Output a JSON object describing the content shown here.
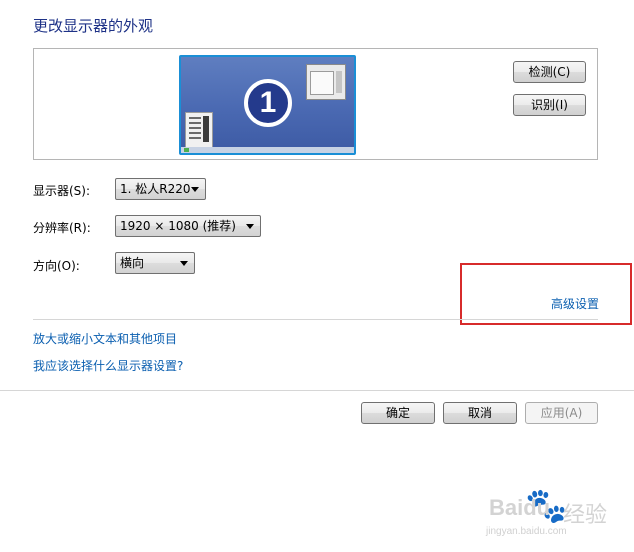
{
  "title": "更改显示器的外观",
  "preview": {
    "monitor_number": "1",
    "detect_label": "检测(C)",
    "identify_label": "识别(I)"
  },
  "settings": {
    "display_label": "显示器(S):",
    "display_value": "1. 松人R220",
    "resolution_label": "分辨率(R):",
    "resolution_value": "1920 × 1080 (推荐)",
    "orientation_label": "方向(O):",
    "orientation_value": "横向",
    "advanced_link": "高级设置"
  },
  "links": {
    "text_size": "放大或缩小文本和其他项目",
    "which_settings": "我应该选择什么显示器设置?"
  },
  "footer": {
    "ok": "确定",
    "cancel": "取消",
    "apply": "应用(A)"
  },
  "colors": {
    "link": "#0b5fb0",
    "title": "#1e3287",
    "highlight": "#d72b2b"
  },
  "watermark": {
    "brand": "Baidu",
    "brand_cn": "经验",
    "url": "jingyan.baidu.com"
  }
}
